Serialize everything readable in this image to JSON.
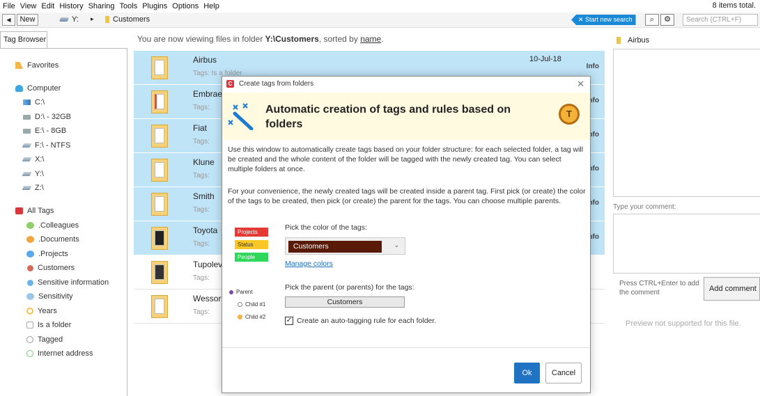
{
  "menu": [
    "File",
    "View",
    "Edit",
    "History",
    "Sharing",
    "Tools",
    "Plugins",
    "Options",
    "Help"
  ],
  "items_total": "8 items total.",
  "toolbar": {
    "back": "◀",
    "new_label": "New",
    "crumbs": [
      "Y:",
      "▸",
      "Customers"
    ],
    "start_search": "✕ Start new search",
    "search_placeholder": "Search (CTRL+F)"
  },
  "left": {
    "tab": "Tag Browser",
    "items": [
      {
        "label": "Favorites",
        "icon": "favorites-icon"
      },
      {
        "label": "Computer",
        "icon": "computer-icon"
      },
      {
        "label": "C:\\",
        "icon": "windows-drive-icon"
      },
      {
        "label": "D:\\ - 32GB",
        "icon": "hard-drive-icon"
      },
      {
        "label": "E:\\ - 8GB",
        "icon": "hard-drive-icon"
      },
      {
        "label": "F:\\ - NTFS",
        "icon": "usb-drive-icon"
      },
      {
        "label": "X:\\",
        "icon": "network-drive-icon"
      },
      {
        "label": "Y:\\",
        "icon": "network-drive-icon"
      },
      {
        "label": "Z:\\",
        "icon": "network-drive-icon"
      },
      {
        "label": "All Tags",
        "icon": "tags-icon"
      },
      {
        "label": ".Colleagues",
        "icon": "tag-category-icon"
      },
      {
        "label": ".Documents",
        "icon": "tag-category-icon"
      },
      {
        "label": ".Projects",
        "icon": "tag-category-icon"
      },
      {
        "label": "Customers",
        "icon": "tag-dot-icon"
      },
      {
        "label": "Sensitive information",
        "icon": "tag-dot-icon"
      },
      {
        "label": "Sensitivity",
        "icon": "tag-category-icon"
      },
      {
        "label": "Years",
        "icon": "tag-ring-icon"
      },
      {
        "label": "Is a folder",
        "icon": "tag-square-icon"
      },
      {
        "label": "Tagged",
        "icon": "tag-ring-icon"
      },
      {
        "label": "Internet address",
        "icon": "tag-ring-icon"
      }
    ]
  },
  "main": {
    "prefix": "You are now viewing files in folder ",
    "folder": "Y:\\Customers",
    "mid": ", sorted by ",
    "sort": "name",
    "suffix": ".",
    "tags_label": "Tags:",
    "first_tag": "Is a folder",
    "info_label": "Info",
    "files": [
      {
        "name": "Airbus",
        "date": "10-Jul-18"
      },
      {
        "name": "Embrae",
        "date": ""
      },
      {
        "name": "Fiat",
        "date": ""
      },
      {
        "name": "Klune",
        "date": ""
      },
      {
        "name": "Smith",
        "date": ""
      },
      {
        "name": "Toyota",
        "date": ""
      },
      {
        "name": "Tupolev",
        "date": ""
      },
      {
        "name": "Wessor",
        "date": ""
      }
    ]
  },
  "right": {
    "title": "Airbus",
    "comment_label": "Type your comment:",
    "hint": "Press CTRL+Enter to add the comment",
    "add_button": "Add comment",
    "no_preview": "Preview not supported for this file."
  },
  "dialog": {
    "title": "Create tags from folders",
    "heading": "Automatic creation of tags and rules based on folders",
    "p1": "Use this window to automatically create tags based on your folder structure: for each selected folder, a tag will be created and the whole content of the folder will be tagged with the newly created tag. You can select multiple folders at once.",
    "p2": "For your convenience, the newly created tags will be created inside a parent tag. First pick (or create) the color of the tags to be created, then pick (or create) the parent for the tags. You can choose multiple parents.",
    "legend": [
      {
        "label": "Projects",
        "color": "#e53935"
      },
      {
        "label": "Status",
        "color": "#f9c726"
      },
      {
        "label": "People",
        "color": "#2fd75a"
      }
    ],
    "pick_color_label": "Pick the color of the tags:",
    "selected_color": "Customers",
    "selected_color_hex": "#5a1a08",
    "manage_colors": "Manage colors",
    "pick_parent_label": "Pick the parent (or parents) for the tags:",
    "parent_value": "Customers",
    "tree": [
      "Parent",
      "Child #1",
      "Child #2"
    ],
    "auto_rule_label": "Create an auto-tagging rule for each folder.",
    "auto_rule_checked": true,
    "ok": "Ok",
    "cancel": "Cancel"
  }
}
